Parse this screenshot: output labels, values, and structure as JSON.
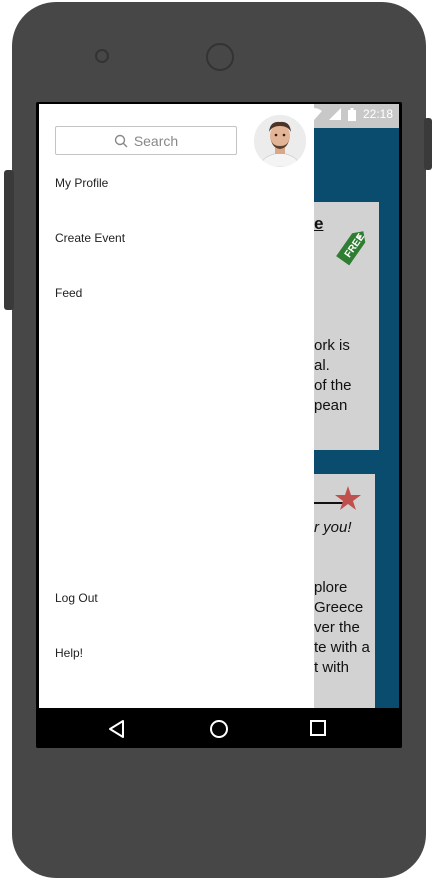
{
  "status_bar": {
    "time": "22:18",
    "wifi_icon": "wifi-icon",
    "signal_icon": "signal-icon",
    "battery_icon": "battery-icon"
  },
  "drawer": {
    "search_placeholder": "Search",
    "menu_top": [
      "My Profile",
      "Create Event",
      "Feed"
    ],
    "menu_bottom": [
      "Log Out",
      "Help!"
    ]
  },
  "background": {
    "card1": {
      "title_fragment": "e",
      "badge": "FREE",
      "lines": [
        "ork is",
        "al.",
        "of the",
        "pean"
      ]
    },
    "card2": {
      "subtitle_fragment": "r you!",
      "lines": [
        "plore",
        "Greece",
        "ver the",
        "te with a",
        "t with"
      ]
    }
  },
  "navbar": {
    "back": "back-icon",
    "home": "home-icon",
    "recents": "recents-icon"
  },
  "colors": {
    "app_background": "#0a4c6d",
    "card": "#d2d2d2",
    "free_badge": "#2e7d32",
    "star": "#c0504d"
  }
}
